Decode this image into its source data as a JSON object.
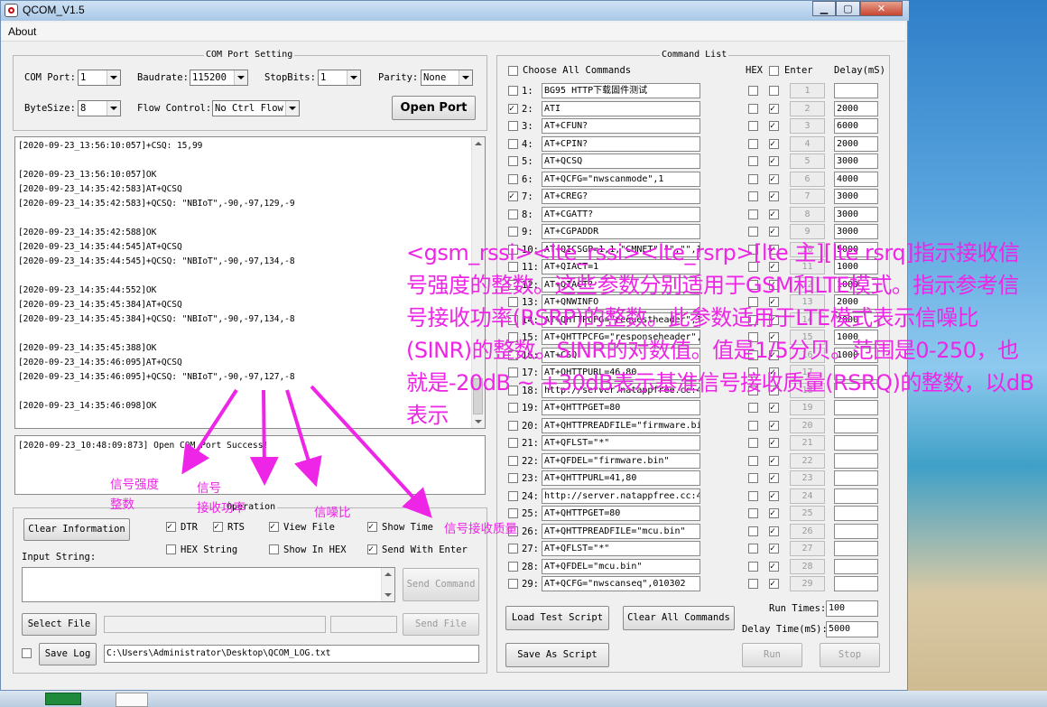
{
  "window": {
    "title": "QCOM_V1.5",
    "menu_about": "About"
  },
  "port_setting": {
    "group_title": "COM Port Setting",
    "com_port_label": "COM Port:",
    "com_port_value": "1",
    "baudrate_label": "Baudrate:",
    "baudrate_value": "115200",
    "stopbits_label": "StopBits:",
    "stopbits_value": "1",
    "parity_label": "Parity:",
    "parity_value": "None",
    "bytesize_label": "ByteSize:",
    "bytesize_value": "8",
    "flow_label": "Flow Control:",
    "flow_value": "No Ctrl Flow",
    "open_port_label": "Open Port"
  },
  "log_lines": [
    "[2020-09-23_13:56:10:057]+CSQ: 15,99",
    "",
    "[2020-09-23_13:56:10:057]OK",
    "[2020-09-23_14:35:42:583]AT+QCSQ",
    "[2020-09-23_14:35:42:583]+QCSQ: \"NBIoT\",-90,-97,129,-9",
    "",
    "[2020-09-23_14:35:42:588]OK",
    "[2020-09-23_14:35:44:545]AT+QCSQ",
    "[2020-09-23_14:35:44:545]+QCSQ: \"NBIoT\",-90,-97,134,-8",
    "",
    "[2020-09-23_14:35:44:552]OK",
    "[2020-09-23_14:35:45:384]AT+QCSQ",
    "[2020-09-23_14:35:45:384]+QCSQ: \"NBIoT\",-90,-97,134,-8",
    "",
    "[2020-09-23_14:35:45:388]OK",
    "[2020-09-23_14:35:46:095]AT+QCSQ",
    "[2020-09-23_14:35:46:095]+QCSQ: \"NBIoT\",-90,-97,127,-8",
    "",
    "[2020-09-23_14:35:46:098]OK"
  ],
  "status_log": "[2020-09-23_10:48:09:873] Open COM Port Success!",
  "operation": {
    "group_title": "Operation",
    "clear_info": "Clear Information",
    "dtr": "DTR",
    "rts": "RTS",
    "view_file": "View File",
    "show_time": "Show Time",
    "hex_string": "HEX String",
    "show_in_hex": "Show In HEX",
    "send_with_enter": "Send With Enter",
    "input_string_label": "Input String:",
    "send_command": "Send Command",
    "select_file": "Select File",
    "send_file": "Send File",
    "save_log": "Save Log",
    "log_path": "C:\\Users\\Administrator\\Desktop\\QCOM_LOG.txt"
  },
  "command_list": {
    "group_title": "Command List",
    "choose_all": "Choose All Commands",
    "hex_header": "HEX",
    "enter_header": "Enter",
    "delay_header": "Delay(mS)",
    "rows": [
      {
        "num": "1:",
        "cmd": "BG95 HTTP下载固件测试",
        "checked": false,
        "hex": false,
        "enter": false,
        "btn": "1",
        "delay": ""
      },
      {
        "num": "2:",
        "cmd": "ATI",
        "checked": true,
        "hex": false,
        "enter": true,
        "btn": "2",
        "delay": "2000"
      },
      {
        "num": "3:",
        "cmd": "AT+CFUN?",
        "checked": false,
        "hex": false,
        "enter": true,
        "btn": "3",
        "delay": "6000"
      },
      {
        "num": "4:",
        "cmd": "AT+CPIN?",
        "checked": false,
        "hex": false,
        "enter": true,
        "btn": "4",
        "delay": "2000"
      },
      {
        "num": "5:",
        "cmd": "AT+QCSQ",
        "checked": false,
        "hex": false,
        "enter": true,
        "btn": "5",
        "delay": "3000"
      },
      {
        "num": "6:",
        "cmd": "AT+QCFG=\"nwscanmode\",1",
        "checked": false,
        "hex": false,
        "enter": true,
        "btn": "6",
        "delay": "4000"
      },
      {
        "num": "7:",
        "cmd": "AT+CREG?",
        "checked": true,
        "hex": false,
        "enter": true,
        "btn": "7",
        "delay": "3000"
      },
      {
        "num": "8:",
        "cmd": "AT+CGATT?",
        "checked": false,
        "hex": false,
        "enter": true,
        "btn": "8",
        "delay": "3000"
      },
      {
        "num": "9:",
        "cmd": "AT+CGPADDR",
        "checked": false,
        "hex": false,
        "enter": true,
        "btn": "9",
        "delay": "3000"
      },
      {
        "num": "10:",
        "cmd": "AT+QICSGP=1,1,\"CMNET\",\"\",\"\",1",
        "checked": false,
        "hex": false,
        "enter": true,
        "btn": "10",
        "delay": "5000"
      },
      {
        "num": "11:",
        "cmd": "AT+QIACT=1",
        "checked": false,
        "hex": false,
        "enter": true,
        "btn": "11",
        "delay": "1000"
      },
      {
        "num": "12:",
        "cmd": "AT+QIACT?",
        "checked": false,
        "hex": false,
        "enter": true,
        "btn": "12",
        "delay": "1000"
      },
      {
        "num": "13:",
        "cmd": "AT+QNWINFO",
        "checked": false,
        "hex": false,
        "enter": true,
        "btn": "13",
        "delay": "2000"
      },
      {
        "num": "14:",
        "cmd": "AT+QHTTPCFG=\"requestheader\",1",
        "checked": false,
        "hex": false,
        "enter": true,
        "btn": "14",
        "delay": "2000"
      },
      {
        "num": "15:",
        "cmd": "AT+QHTTPCFG=\"responseheader\",0",
        "checked": false,
        "hex": false,
        "enter": true,
        "btn": "15",
        "delay": "1000"
      },
      {
        "num": "16:",
        "cmd": "AT+CSQ",
        "checked": false,
        "hex": false,
        "enter": true,
        "btn": "16",
        "delay": "1000"
      },
      {
        "num": "17:",
        "cmd": "AT+QHTTPURL=46,80",
        "checked": false,
        "hex": false,
        "enter": true,
        "btn": "17",
        "delay": ""
      },
      {
        "num": "18:",
        "cmd": "http://server.natappfree.cc:44261/f",
        "checked": false,
        "hex": false,
        "enter": true,
        "btn": "18",
        "delay": ""
      },
      {
        "num": "19:",
        "cmd": "AT+QHTTPGET=80",
        "checked": false,
        "hex": false,
        "enter": true,
        "btn": "19",
        "delay": ""
      },
      {
        "num": "20:",
        "cmd": "AT+QHTTPREADFILE=\"firmware.bin\"",
        "checked": false,
        "hex": false,
        "enter": true,
        "btn": "20",
        "delay": ""
      },
      {
        "num": "21:",
        "cmd": "AT+QFLST=\"*\"",
        "checked": false,
        "hex": false,
        "enter": true,
        "btn": "21",
        "delay": ""
      },
      {
        "num": "22:",
        "cmd": "AT+QFDEL=\"firmware.bin\"",
        "checked": false,
        "hex": false,
        "enter": true,
        "btn": "22",
        "delay": ""
      },
      {
        "num": "23:",
        "cmd": "AT+QHTTPURL=41,80",
        "checked": false,
        "hex": false,
        "enter": true,
        "btn": "23",
        "delay": ""
      },
      {
        "num": "24:",
        "cmd": "http://server.natappfree.cc:44261/m",
        "checked": false,
        "hex": false,
        "enter": true,
        "btn": "24",
        "delay": ""
      },
      {
        "num": "25:",
        "cmd": "AT+QHTTPGET=80",
        "checked": false,
        "hex": false,
        "enter": true,
        "btn": "25",
        "delay": ""
      },
      {
        "num": "26:",
        "cmd": "AT+QHTTPREADFILE=\"mcu.bin\"",
        "checked": false,
        "hex": false,
        "enter": true,
        "btn": "26",
        "delay": ""
      },
      {
        "num": "27:",
        "cmd": "AT+QFLST=\"*\"",
        "checked": false,
        "hex": false,
        "enter": true,
        "btn": "27",
        "delay": ""
      },
      {
        "num": "28:",
        "cmd": "AT+QFDEL=\"mcu.bin\"",
        "checked": false,
        "hex": false,
        "enter": true,
        "btn": "28",
        "delay": ""
      },
      {
        "num": "29:",
        "cmd": "AT+QCFG=\"nwscanseq\",010302",
        "checked": false,
        "hex": false,
        "enter": true,
        "btn": "29",
        "delay": ""
      }
    ],
    "load_script": "Load Test Script",
    "clear_all": "Clear All Commands",
    "save_script": "Save As Script",
    "run_times_label": "Run Times:",
    "run_times_value": "100",
    "delay_time_label": "Delay Time(mS):",
    "delay_time_value": "5000",
    "run": "Run",
    "stop": "Stop"
  },
  "annotation": {
    "text": "<gsm_rssi><lte_rssi><lte_rsrp>[lte 主][lte rsrq]指示接收信号强度的整数。这些参数分别适用于GSM和LTE模式。指示参考信号接收功率(RSRP)的整数。此参数适用于LTE模式表示信噪比(SINR)的整数。SINR的对数值。值是1/5分贝。范围是0-250，也就是-20dB ~ +30dB表示基准信号接收质量(RSRQ)的整数，以dB表示",
    "label_rssi_1": "信号强度",
    "label_rssi_2": "整数",
    "label_rsrp_1": "信号",
    "label_rsrp_2": "接收功率",
    "label_sinr": "信噪比",
    "label_rsrq": "信号接收质量",
    "color": "#ee25e6"
  }
}
